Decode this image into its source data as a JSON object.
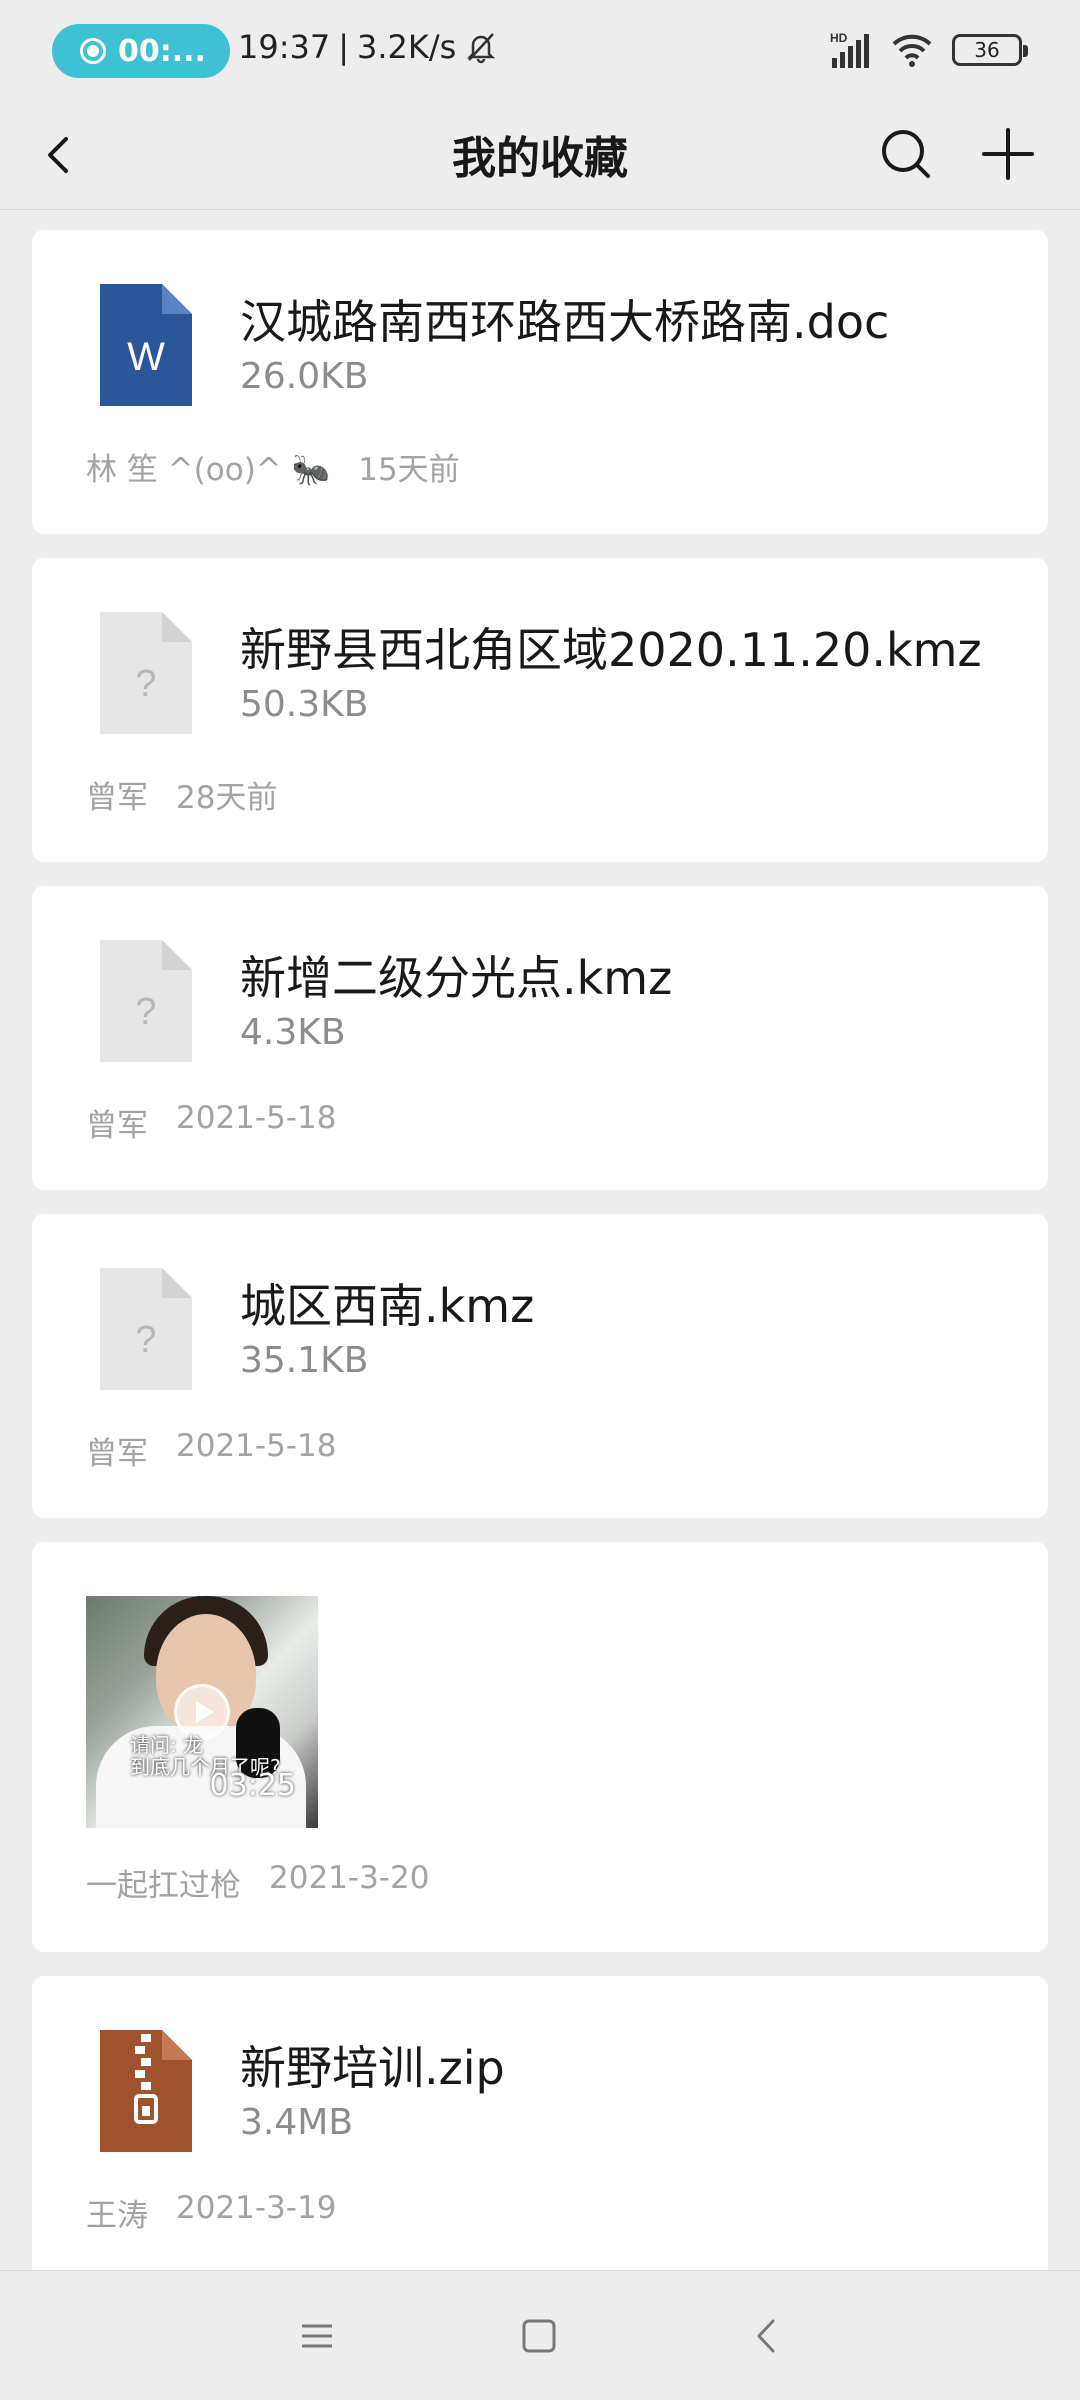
{
  "status_bar": {
    "recording_label": "00:...",
    "time": "19:37",
    "separator": "|",
    "network_speed": "3.2K/s",
    "signal_badge": "HD",
    "battery_level": "36",
    "icons": [
      "record-icon",
      "mute-icon",
      "signal-icon",
      "wifi-icon",
      "battery-icon"
    ]
  },
  "header": {
    "title": "我的收藏",
    "icons": [
      "back-icon",
      "search-icon",
      "add-icon"
    ]
  },
  "items": [
    {
      "type": "doc",
      "icon_letter": "W",
      "name": "汉城路南西环路西大桥路南.doc",
      "size": "26.0KB",
      "author": "林 笙 ^(oo)^ 🐜",
      "date": "15天前"
    },
    {
      "type": "unknown",
      "icon_glyph": "?",
      "name": "新野县西北角区域2020.11.20.kmz",
      "size": "50.3KB",
      "author": "曾军",
      "date": "28天前"
    },
    {
      "type": "unknown",
      "icon_glyph": "?",
      "name": "新增二级分光点.kmz",
      "size": "4.3KB",
      "author": "曾军",
      "date": "2021-5-18"
    },
    {
      "type": "unknown",
      "icon_glyph": "?",
      "name": "城区西南.kmz",
      "size": "35.1KB",
      "author": "曾军",
      "date": "2021-5-18"
    },
    {
      "type": "video",
      "duration": "03:25",
      "caption_line1": "请问: 龙",
      "caption_line2": "到底几个月了呢?",
      "author": "一起扛过枪",
      "date": "2021-3-20"
    },
    {
      "type": "zip",
      "name": "新野培训.zip",
      "size": "3.4MB",
      "author": "王涛",
      "date": "2021-3-19"
    }
  ],
  "colors": {
    "background": "#ededed",
    "card": "#ffffff",
    "word_blue": "#2b579a",
    "zip_brown": "#a0522d",
    "unknown_gray": "#e6e6e6",
    "record_pill": "#3fc1d4"
  },
  "nav_bar": {
    "icons": [
      "menu-icon",
      "home-icon",
      "back-nav-icon"
    ]
  }
}
